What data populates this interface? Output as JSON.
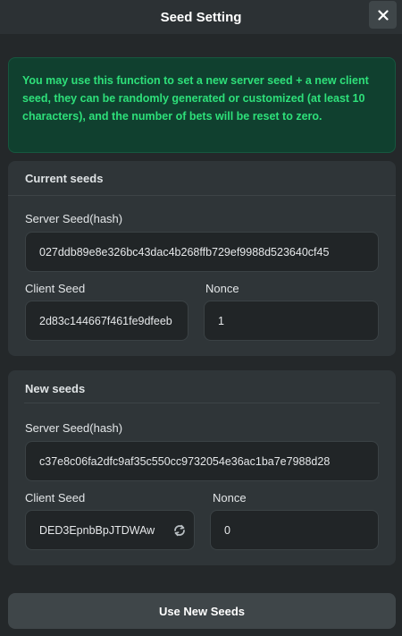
{
  "header": {
    "title": "Seed Setting",
    "close_icon": "close-icon"
  },
  "notice": {
    "text": "You may use this function to set a new server seed + a new client seed, they can be randomly generated or customized (at least 10 characters), and the number of bets will be reset to zero."
  },
  "current_seeds": {
    "title": "Current seeds",
    "server_seed_label": "Server Seed(hash)",
    "server_seed_value": "027ddb89e8e326bc43dac4b268ffb729ef9988d523640cf45",
    "client_seed_label": "Client Seed",
    "client_seed_value": "2d83c144667f461fe9dfeeb",
    "nonce_label": "Nonce",
    "nonce_value": "1"
  },
  "new_seeds": {
    "title": "New seeds",
    "server_seed_label": "Server Seed(hash)",
    "server_seed_value": "c37e8c06fa2dfc9af35c550cc9732054e36ac1ba7e7988d28",
    "client_seed_label": "Client Seed",
    "client_seed_value": "DED3EpnbBpJTDWAw",
    "refresh_icon": "refresh-icon",
    "nonce_label": "Nonce",
    "nonce_value": "0"
  },
  "actions": {
    "use_new_seeds": "Use New Seeds"
  },
  "colors": {
    "background": "#24282a",
    "panel": "#2f3538",
    "notice_bg": "#10402f",
    "notice_text": "#2ee07a",
    "button": "#3f4649"
  }
}
